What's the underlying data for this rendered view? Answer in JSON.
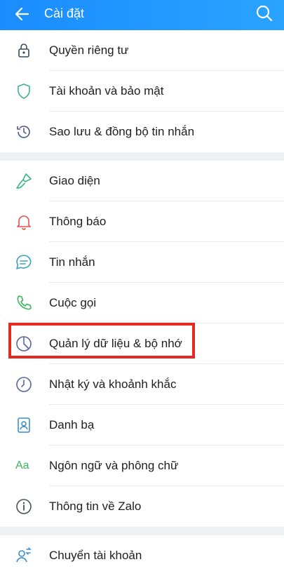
{
  "header": {
    "title": "Cài đặt",
    "back_icon": "arrow-left-icon",
    "search_icon": "search-icon"
  },
  "group1": [
    {
      "label": "Quyền riêng tư",
      "icon": "lock-icon"
    },
    {
      "label": "Tài khoản và bảo mật",
      "icon": "shield-icon"
    },
    {
      "label": "Sao lưu & đồng bộ tin nhắn",
      "icon": "history-icon"
    }
  ],
  "group2": [
    {
      "label": "Giao diện",
      "icon": "paint-brush-icon"
    },
    {
      "label": "Thông báo",
      "icon": "bell-icon"
    },
    {
      "label": "Tin nhắn",
      "icon": "chat-icon"
    },
    {
      "label": "Cuộc gọi",
      "icon": "phone-icon"
    },
    {
      "label": "Quản lý dữ liệu & bộ nhớ",
      "icon": "pie-chart-icon"
    },
    {
      "label": "Nhật ký và khoảnh khắc",
      "icon": "clock-icon"
    },
    {
      "label": "Danh bạ",
      "icon": "contacts-icon"
    },
    {
      "label": "Ngôn ngữ và phông chữ",
      "icon": "language-icon",
      "glyph": "Aa"
    },
    {
      "label": "Thông tin về Zalo",
      "icon": "info-icon"
    }
  ],
  "group3": [
    {
      "label": "Chuyển tài khoản",
      "icon": "switch-account-icon"
    }
  ],
  "colors": {
    "header": "#1a8cff",
    "highlight": "#e32b21",
    "separator": "#eef0f2"
  }
}
